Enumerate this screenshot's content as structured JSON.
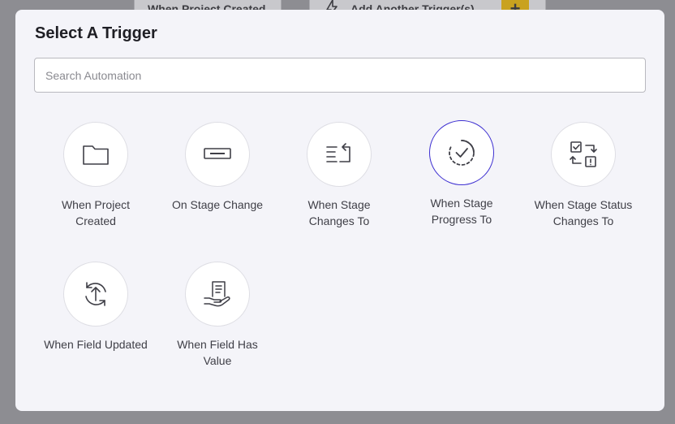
{
  "background": {
    "card1_label": "When Project Created",
    "card2_label": "Add Another Trigger(s)",
    "add_symbol": "+"
  },
  "modal": {
    "title": "Select A Trigger",
    "search_placeholder": "Search Automation",
    "search_value": "",
    "selected_trigger": "When Stage Progress To",
    "triggers": [
      {
        "label": "When Project Created",
        "icon": "folder-icon"
      },
      {
        "label": "On Stage Change",
        "icon": "stage-bar-icon"
      },
      {
        "label": "When Stage Changes To",
        "icon": "list-arrow-icon"
      },
      {
        "label": "When Stage Progress To",
        "icon": "progress-check-icon"
      },
      {
        "label": "When Stage Status Changes To",
        "icon": "status-swap-icon"
      },
      {
        "label": "When Field Updated",
        "icon": "refresh-up-icon"
      },
      {
        "label": "When Field Has Value",
        "icon": "hand-document-icon"
      }
    ]
  },
  "colors": {
    "accent": "#3d2fd1",
    "modal_bg": "#f4f4f9",
    "overlay": "#8d8d92"
  }
}
